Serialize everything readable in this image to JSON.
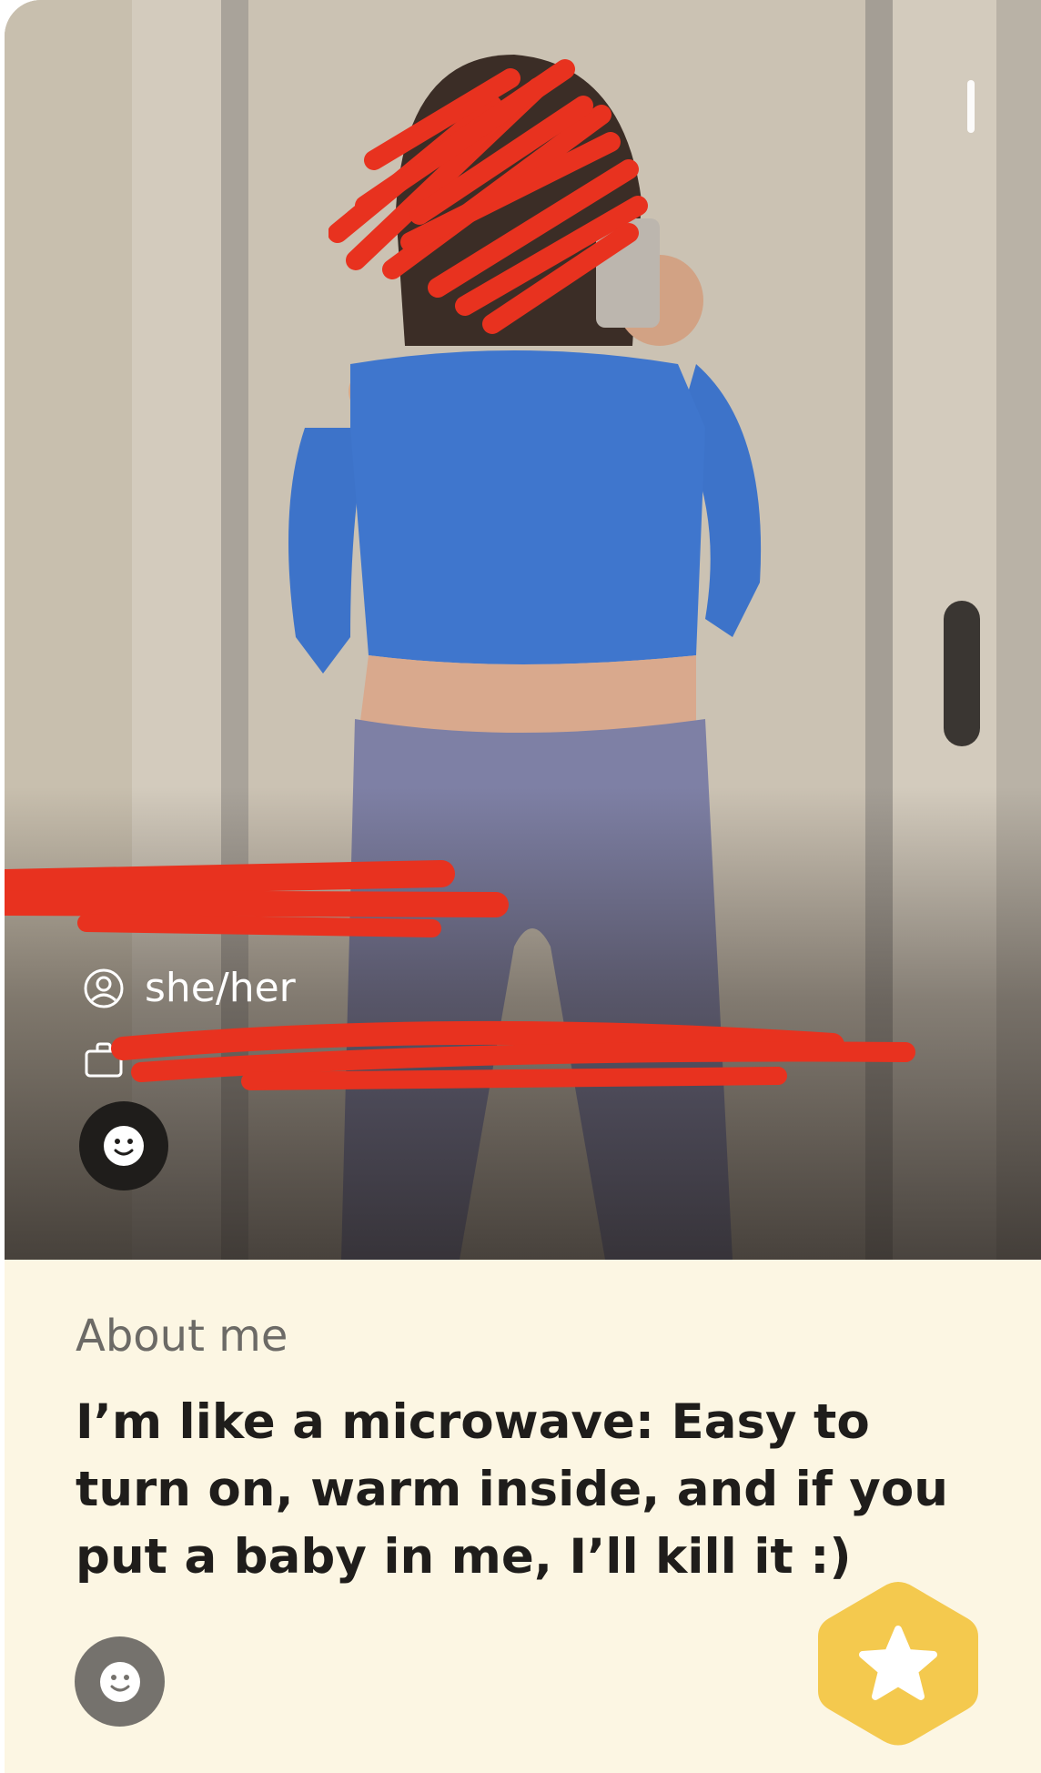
{
  "profile": {
    "pronouns": "she/her",
    "pronouns_icon": "person-circle-icon",
    "work_icon": "briefcase-icon",
    "reaction_icon": "smiley-icon"
  },
  "about": {
    "title": "About me",
    "text": "I’m like a microwave: Easy to turn on, warm inside, and if you put a baby in me, I’ll kill it :)",
    "reaction_icon": "smiley-icon"
  },
  "actions": {
    "superswipe_icon": "star-icon"
  },
  "colors": {
    "about_background": "#fcf6e3",
    "superswipe_yellow": "#f4c94e",
    "redaction_red": "#e8321f",
    "text_dark": "#1f1d1b",
    "text_muted": "#6c6a66"
  }
}
